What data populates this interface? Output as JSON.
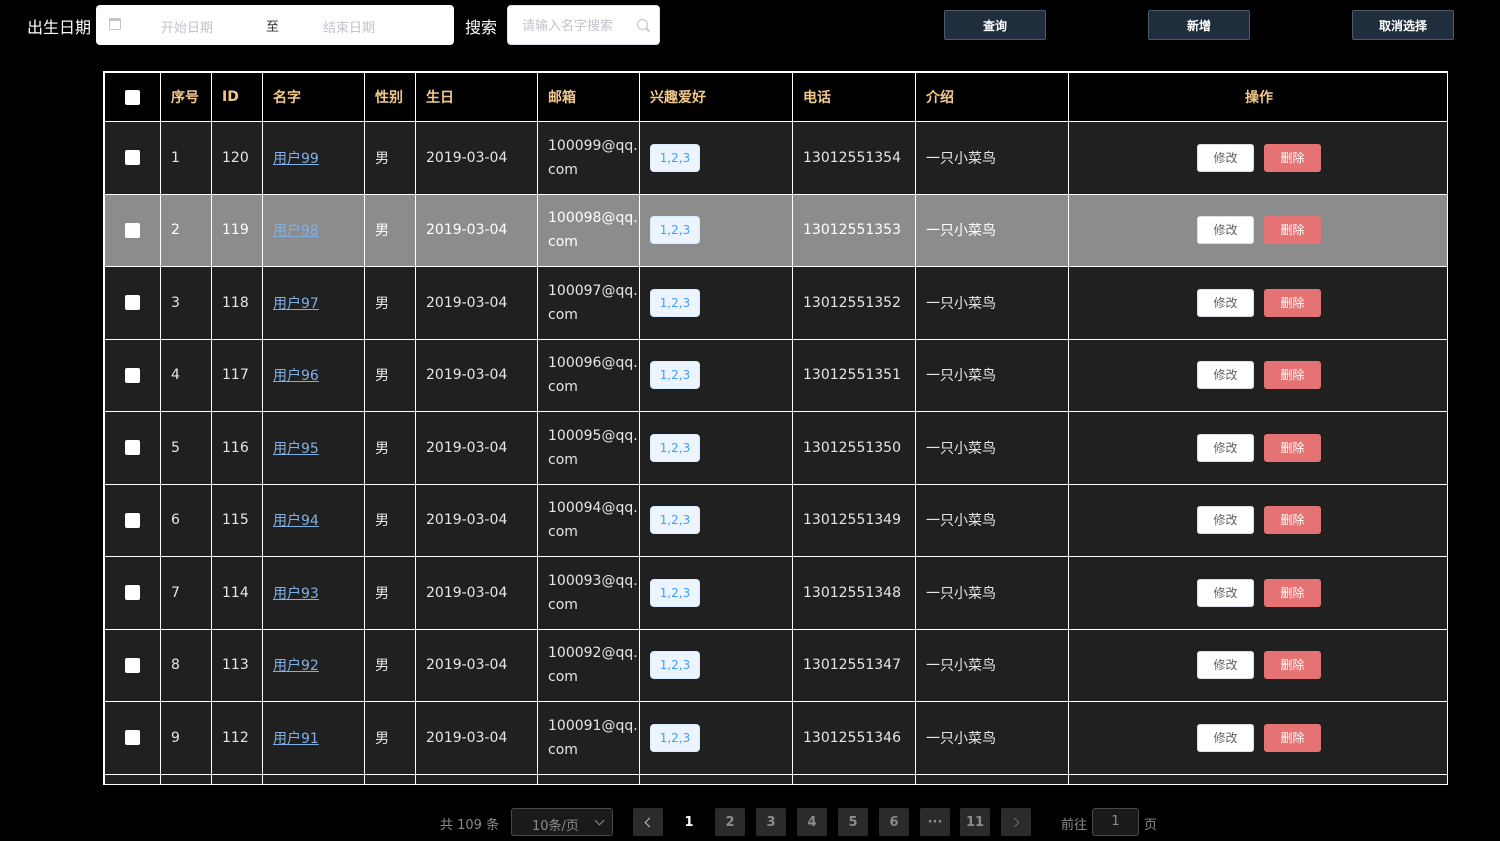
{
  "filters": {
    "birth_label": "出生日期",
    "start_placeholder": "开始日期",
    "range_separator": "至",
    "end_placeholder": "结束日期",
    "search_label": "搜索",
    "search_placeholder": "请输入名字搜索"
  },
  "toolbar": {
    "query_label": "查询",
    "add_label": "新增",
    "deselect_label": "取消选择"
  },
  "table": {
    "headers": {
      "index": "序号",
      "id": "ID",
      "name": "名字",
      "gender": "性别",
      "birthday": "生日",
      "email": "邮箱",
      "hobbies": "兴趣爱好",
      "phone": "电话",
      "intro": "介绍",
      "ops": "操作"
    },
    "edit_label": "修改",
    "delete_label": "删除",
    "rows": [
      {
        "index": "1",
        "id": "120",
        "name": "用户99",
        "gender": "男",
        "birthday": "2019-03-04",
        "email_a": "100099@qq.",
        "email_b": "com",
        "hobbies": "1,2,3",
        "phone": "13012551354",
        "intro": "一只小菜鸟"
      },
      {
        "index": "2",
        "id": "119",
        "name": "用户98",
        "gender": "男",
        "birthday": "2019-03-04",
        "email_a": "100098@qq.",
        "email_b": "com",
        "hobbies": "1,2,3",
        "phone": "13012551353",
        "intro": "一只小菜鸟"
      },
      {
        "index": "3",
        "id": "118",
        "name": "用户97",
        "gender": "男",
        "birthday": "2019-03-04",
        "email_a": "100097@qq.",
        "email_b": "com",
        "hobbies": "1,2,3",
        "phone": "13012551352",
        "intro": "一只小菜鸟"
      },
      {
        "index": "4",
        "id": "117",
        "name": "用户96",
        "gender": "男",
        "birthday": "2019-03-04",
        "email_a": "100096@qq.",
        "email_b": "com",
        "hobbies": "1,2,3",
        "phone": "13012551351",
        "intro": "一只小菜鸟"
      },
      {
        "index": "5",
        "id": "116",
        "name": "用户95",
        "gender": "男",
        "birthday": "2019-03-04",
        "email_a": "100095@qq.",
        "email_b": "com",
        "hobbies": "1,2,3",
        "phone": "13012551350",
        "intro": "一只小菜鸟"
      },
      {
        "index": "6",
        "id": "115",
        "name": "用户94",
        "gender": "男",
        "birthday": "2019-03-04",
        "email_a": "100094@qq.",
        "email_b": "com",
        "hobbies": "1,2,3",
        "phone": "13012551349",
        "intro": "一只小菜鸟"
      },
      {
        "index": "7",
        "id": "114",
        "name": "用户93",
        "gender": "男",
        "birthday": "2019-03-04",
        "email_a": "100093@qq.",
        "email_b": "com",
        "hobbies": "1,2,3",
        "phone": "13012551348",
        "intro": "一只小菜鸟"
      },
      {
        "index": "8",
        "id": "113",
        "name": "用户92",
        "gender": "男",
        "birthday": "2019-03-04",
        "email_a": "100092@qq.",
        "email_b": "com",
        "hobbies": "1,2,3",
        "phone": "13012551347",
        "intro": "一只小菜鸟"
      },
      {
        "index": "9",
        "id": "112",
        "name": "用户91",
        "gender": "男",
        "birthday": "2019-03-04",
        "email_a": "100091@qq.",
        "email_b": "com",
        "hobbies": "1,2,3",
        "phone": "13012551346",
        "intro": "一只小菜鸟"
      }
    ]
  },
  "pagination": {
    "total_text": "共 109 条",
    "page_size": "10条/页",
    "pages": [
      "1",
      "2",
      "3",
      "4",
      "5",
      "6",
      "···",
      "11"
    ],
    "current": "1",
    "goto_label": "前往",
    "goto_value": "1",
    "page_unit": "页"
  },
  "colors": {
    "header_text": "#f3c98b",
    "row_bg": "#202020",
    "highlight_row_bg": "#8c8c8c",
    "delete_button": "#e57373",
    "link": "#7fb0e6",
    "tag_text": "#409eff"
  }
}
